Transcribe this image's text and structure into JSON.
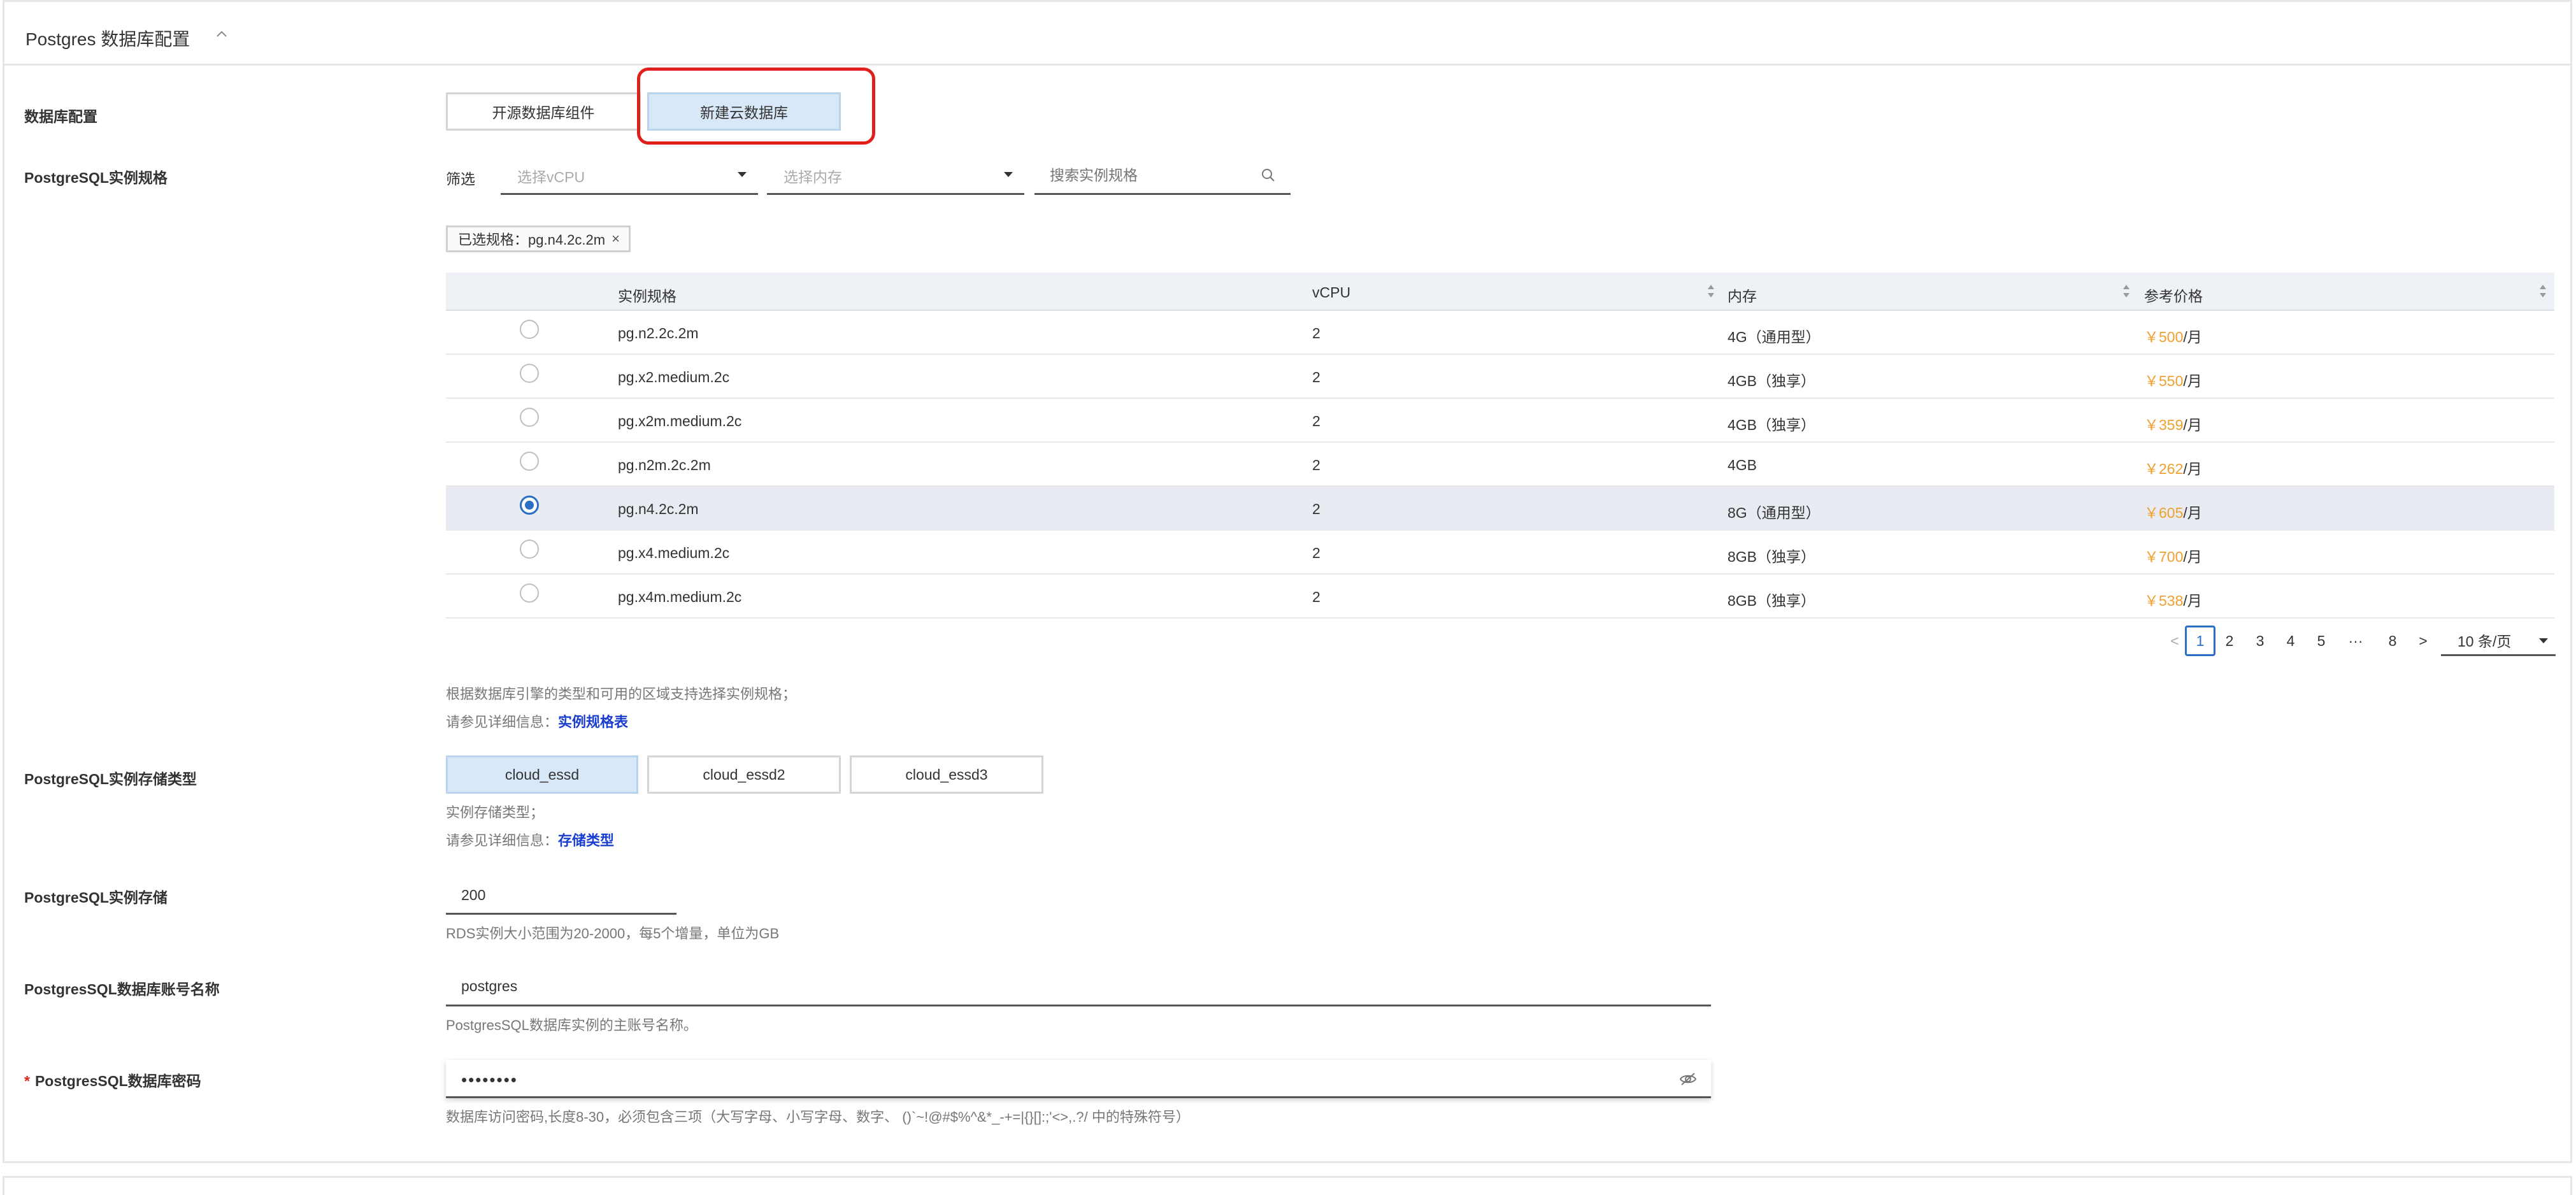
{
  "section": {
    "title": "Postgres 数据库配置"
  },
  "db_config": {
    "label": "数据库配置",
    "options": [
      "开源数据库组件",
      "新建云数据库"
    ],
    "selected_index": 1
  },
  "instance_spec": {
    "label": "PostgreSQL实例规格",
    "filter_label": "筛选",
    "vcpu_placeholder": "选择vCPU",
    "memory_placeholder": "选择内存",
    "search_placeholder": "搜索实例规格",
    "selected_tag": "已选规格：pg.n4.2c.2m",
    "table": {
      "columns": [
        "实例规格",
        "vCPU",
        "内存",
        "参考价格"
      ],
      "rows": [
        {
          "spec": "pg.n2.2c.2m",
          "vcpu": "2",
          "memory": "4G（通用型）",
          "price": "￥500",
          "unit": "/月",
          "selected": false
        },
        {
          "spec": "pg.x2.medium.2c",
          "vcpu": "2",
          "memory": "4GB（独享）",
          "price": "￥550",
          "unit": "/月",
          "selected": false
        },
        {
          "spec": "pg.x2m.medium.2c",
          "vcpu": "2",
          "memory": "4GB（独享）",
          "price": "￥359",
          "unit": "/月",
          "selected": false
        },
        {
          "spec": "pg.n2m.2c.2m",
          "vcpu": "2",
          "memory": "4GB",
          "price": "￥262",
          "unit": "/月",
          "selected": false
        },
        {
          "spec": "pg.n4.2c.2m",
          "vcpu": "2",
          "memory": "8G（通用型）",
          "price": "￥605",
          "unit": "/月",
          "selected": true
        },
        {
          "spec": "pg.x4.medium.2c",
          "vcpu": "2",
          "memory": "8GB（独享）",
          "price": "￥700",
          "unit": "/月",
          "selected": false
        },
        {
          "spec": "pg.x4m.medium.2c",
          "vcpu": "2",
          "memory": "8GB（独享）",
          "price": "￥538",
          "unit": "/月",
          "selected": false
        }
      ]
    },
    "pagination": {
      "prev": "<",
      "pages": [
        "1",
        "2",
        "3",
        "4",
        "5",
        "···",
        "8"
      ],
      "current": "1",
      "next": ">",
      "page_size": "10 条/页"
    },
    "help_line1": "根据数据库引擎的类型和可用的区域支持选择实例规格；",
    "help_line2_prefix": "请参见详细信息：",
    "help_line2_link": "实例规格表"
  },
  "storage_type": {
    "label": "PostgreSQL实例存储类型",
    "options": [
      "cloud_essd",
      "cloud_essd2",
      "cloud_essd3"
    ],
    "selected_index": 0,
    "help_line1": "实例存储类型；",
    "help_line2_prefix": "请参见详细信息：",
    "help_line2_link": "存储类型"
  },
  "storage": {
    "label": "PostgreSQL实例存储",
    "value": "200",
    "help": "RDS实例大小范围为20-2000，每5个增量，单位为GB"
  },
  "account": {
    "label": "PostgresSQL数据库账号名称",
    "value": "postgres",
    "help": "PostgresSQL数据库实例的主账号名称。"
  },
  "password": {
    "required_mark": "*",
    "label": "PostgresSQL数据库密码",
    "masked_value": "••••••••",
    "help": "数据库访问密码,长度8-30，必须包含三项（大写字母、小写字母、数字、 ()`~!@#$%^&*_-+=|{}[]:;'<>,.?/ 中的特殊符号）"
  },
  "colors": {
    "accent": "#2a6ec6",
    "price": "#f0a030",
    "highlight": "#e0201c",
    "active_bg": "#d9e8f8",
    "link": "#1a3ecf"
  }
}
